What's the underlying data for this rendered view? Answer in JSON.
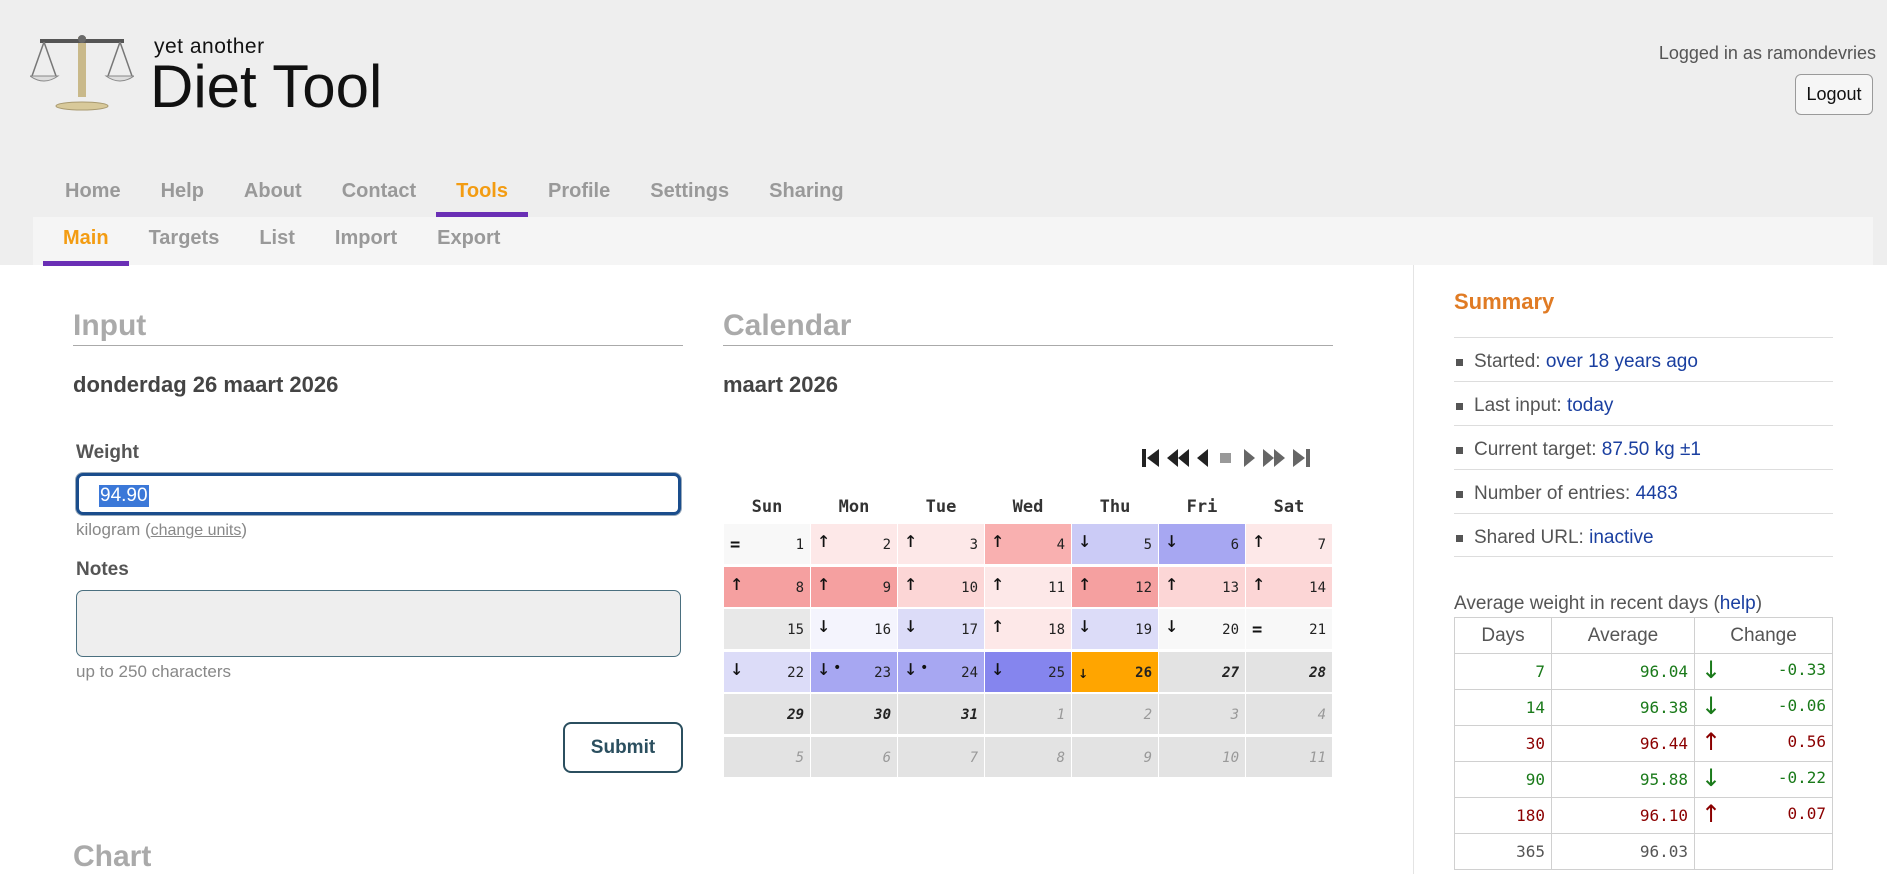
{
  "header": {
    "logo_small": "yet another",
    "logo_big": "Diet Tool",
    "logged_in": "Logged in as ramondevries",
    "logout": "Logout"
  },
  "nav": [
    "Home",
    "Help",
    "About",
    "Contact",
    "Tools",
    "Profile",
    "Settings",
    "Sharing"
  ],
  "nav_active": "Tools",
  "subnav": [
    "Main",
    "Targets",
    "List",
    "Import",
    "Export"
  ],
  "subnav_active": "Main",
  "input": {
    "title": "Input",
    "date": "donderdag 26 maart 2026",
    "weight_label": "Weight",
    "weight_value": "94.90",
    "unit_prefix": "kilogram (",
    "unit_link": "change units",
    "unit_suffix": ")",
    "notes_label": "Notes",
    "notes_hint": "up to 250 characters",
    "submit": "Submit"
  },
  "calendar": {
    "title": "Calendar",
    "month": "maart 2026",
    "days": [
      "Sun",
      "Mon",
      "Tue",
      "Wed",
      "Thu",
      "Fri",
      "Sat"
    ],
    "colors": {
      "up1": "#fde8e8",
      "up2": "#fcd6d6",
      "up3": "#f9b0b0",
      "up4": "#f5a0a0",
      "dn1": "#f4f4fd",
      "dn2": "#dcdcf8",
      "dn3": "#cbcbf6",
      "dn4": "#a7a7f2",
      "dn5": "#8585ee",
      "neutral": "#f8f8f8",
      "none": "#e8e8e8",
      "future": "#e3e3e3",
      "today": "#ffa500"
    },
    "weeks": [
      [
        {
          "day": "1",
          "sym": "=",
          "c": "neutral"
        },
        {
          "day": "2",
          "sym": "↑",
          "c": "up1"
        },
        {
          "day": "3",
          "sym": "↑",
          "c": "up1"
        },
        {
          "day": "4",
          "sym": "↑",
          "c": "up3"
        },
        {
          "day": "5",
          "sym": "↓",
          "c": "dn3"
        },
        {
          "day": "6",
          "sym": "↓",
          "c": "dn4"
        },
        {
          "day": "7",
          "sym": "↑",
          "c": "up1"
        }
      ],
      [
        {
          "day": "8",
          "sym": "↑",
          "c": "up4"
        },
        {
          "day": "9",
          "sym": "↑",
          "c": "up4"
        },
        {
          "day": "10",
          "sym": "↑",
          "c": "up2"
        },
        {
          "day": "11",
          "sym": "↑",
          "c": "up1"
        },
        {
          "day": "12",
          "sym": "↑",
          "c": "up4"
        },
        {
          "day": "13",
          "sym": "↑",
          "c": "up2"
        },
        {
          "day": "14",
          "sym": "↑",
          "c": "up2"
        }
      ],
      [
        {
          "day": "15",
          "sym": "",
          "c": "none"
        },
        {
          "day": "16",
          "sym": "↓",
          "c": "dn1"
        },
        {
          "day": "17",
          "sym": "↓",
          "c": "dn2"
        },
        {
          "day": "18",
          "sym": "↑",
          "c": "up1"
        },
        {
          "day": "19",
          "sym": "↓",
          "c": "dn2"
        },
        {
          "day": "20",
          "sym": "↓",
          "c": "neutral"
        },
        {
          "day": "21",
          "sym": "=",
          "c": "neutral"
        }
      ],
      [
        {
          "day": "22",
          "sym": "↓",
          "c": "dn2"
        },
        {
          "day": "23",
          "sym": "↓",
          "dot": "•",
          "c": "dn4"
        },
        {
          "day": "24",
          "sym": "↓",
          "dot": "•",
          "c": "dn4"
        },
        {
          "day": "25",
          "sym": "↓",
          "c": "dn5"
        },
        {
          "day": "26",
          "sym": "↓",
          "c": "today",
          "t": "today"
        },
        {
          "day": "27",
          "sym": "",
          "c": "future",
          "t": "bold"
        },
        {
          "day": "28",
          "sym": "",
          "c": "future",
          "t": "bold"
        }
      ],
      [
        {
          "day": "29",
          "sym": "",
          "c": "future",
          "t": "bold"
        },
        {
          "day": "30",
          "sym": "",
          "c": "future",
          "t": "bold"
        },
        {
          "day": "31",
          "sym": "",
          "c": "future",
          "t": "bold"
        },
        {
          "day": "1",
          "sym": "",
          "c": "future",
          "t": "next"
        },
        {
          "day": "2",
          "sym": "",
          "c": "future",
          "t": "next"
        },
        {
          "day": "3",
          "sym": "",
          "c": "future",
          "t": "next"
        },
        {
          "day": "4",
          "sym": "",
          "c": "future",
          "t": "next"
        }
      ],
      [
        {
          "day": "5",
          "sym": "",
          "c": "future",
          "t": "next"
        },
        {
          "day": "6",
          "sym": "",
          "c": "future",
          "t": "next"
        },
        {
          "day": "7",
          "sym": "",
          "c": "future",
          "t": "next"
        },
        {
          "day": "8",
          "sym": "",
          "c": "future",
          "t": "next"
        },
        {
          "day": "9",
          "sym": "",
          "c": "future",
          "t": "next"
        },
        {
          "day": "10",
          "sym": "",
          "c": "future",
          "t": "next"
        },
        {
          "day": "11",
          "sym": "",
          "c": "future",
          "t": "next"
        }
      ]
    ]
  },
  "summary": {
    "title": "Summary",
    "items": [
      {
        "label": "Started: ",
        "value": "over 18 years ago"
      },
      {
        "label": "Last input: ",
        "value": "today"
      },
      {
        "label": "Current target: ",
        "value": "87.50 kg ±1"
      },
      {
        "label": "Number of entries: ",
        "value": "4483"
      },
      {
        "label": "Shared URL: ",
        "value": "inactive"
      }
    ],
    "avg_title_prefix": "Average weight in recent days (",
    "avg_help": "help",
    "avg_title_suffix": ")",
    "avg_headers": [
      "Days",
      "Average",
      "Change"
    ],
    "avg_rows": [
      {
        "days": "7",
        "avg": "96.04",
        "arrow": "↓",
        "change": "-0.33",
        "dir": "down"
      },
      {
        "days": "14",
        "avg": "96.38",
        "arrow": "↓",
        "change": "-0.06",
        "dir": "down"
      },
      {
        "days": "30",
        "avg": "96.44",
        "arrow": "↑",
        "change": "0.56",
        "dir": "up"
      },
      {
        "days": "90",
        "avg": "95.88",
        "arrow": "↓",
        "change": "-0.22",
        "dir": "down"
      },
      {
        "days": "180",
        "avg": "96.10",
        "arrow": "↑",
        "change": "0.07",
        "dir": "up"
      },
      {
        "days": "365",
        "avg": "96.03",
        "arrow": "",
        "change": "",
        "dir": "neutral"
      }
    ]
  },
  "chart": {
    "title": "Chart"
  }
}
